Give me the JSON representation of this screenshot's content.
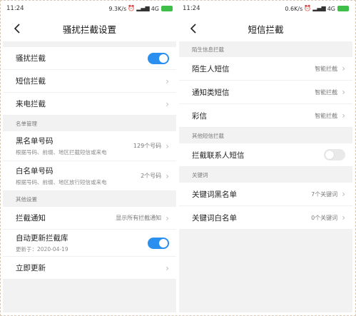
{
  "left": {
    "status": {
      "time": "11:24",
      "speed": "9.3K/s",
      "network": "4G",
      "battery": ""
    },
    "title": "骚扰拦截设置",
    "items_top": [
      {
        "label": "骚扰拦截",
        "toggle": "on"
      },
      {
        "label": "短信拦截"
      },
      {
        "label": "来电拦截"
      }
    ],
    "section_list": "名单管理",
    "blacklist": {
      "label": "黑名单号码",
      "sub": "根据号码、前缀、地区拦截短信或来电",
      "value": "129个号码"
    },
    "whitelist": {
      "label": "白名单号码",
      "sub": "根据号码、前缀、地区放行短信或来电",
      "value": "2个号码"
    },
    "section_other": "其他设置",
    "notify": {
      "label": "拦截通知",
      "value": "显示所有拦截通知"
    },
    "autoupdate": {
      "label": "自动更新拦截库",
      "sub": "更新于：2020-04-19",
      "toggle": "on"
    },
    "update_now": {
      "label": "立即更新"
    }
  },
  "right": {
    "status": {
      "time": "11:24",
      "speed": "0.6K/s",
      "network": "4G",
      "battery": ""
    },
    "title": "短信拦截",
    "section_stranger": "陌生信息拦截",
    "stranger_items": [
      {
        "label": "陌生人短信",
        "value": "智能拦截"
      },
      {
        "label": "通知类短信",
        "value": "智能拦截"
      },
      {
        "label": "彩信",
        "value": "智能拦截"
      }
    ],
    "section_other": "其他短信拦截",
    "contacts": {
      "label": "拦截联系人短信",
      "toggle": "off"
    },
    "section_keyword": "关键词",
    "keyword_black": {
      "label": "关键词黑名单",
      "value": "7个关键词"
    },
    "keyword_white": {
      "label": "关键词白名单",
      "value": "0个关键词"
    }
  },
  "colors": {
    "accent": "#2b8ff0",
    "battery": "#3fbf4a",
    "background": "#f2f2f2"
  },
  "icons": {
    "back": "chevron-left-icon",
    "chevron": "chevron-right-icon",
    "alarm": "alarm-icon",
    "signal": "signal-icon",
    "battery": "battery-icon"
  }
}
